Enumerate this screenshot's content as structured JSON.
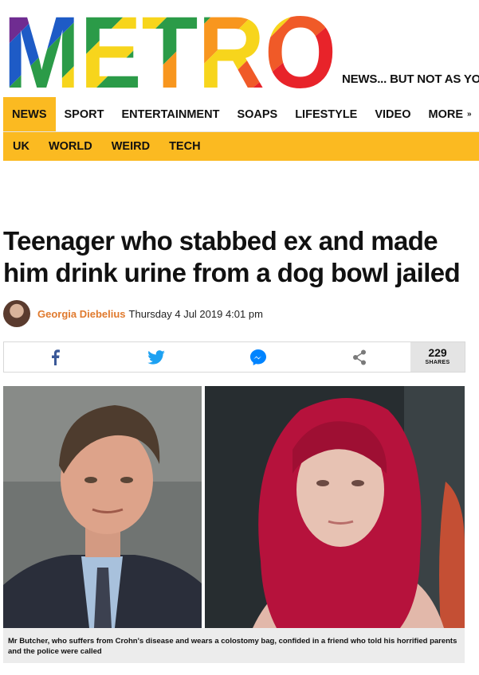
{
  "brand": {
    "logo_text": "METRO",
    "tagline": "NEWS... BUT NOT AS YOU KNOW IT"
  },
  "nav": {
    "primary": [
      "NEWS",
      "SPORT",
      "ENTERTAINMENT",
      "SOAPS",
      "LIFESTYLE",
      "VIDEO",
      "MORE"
    ],
    "active": "NEWS",
    "secondary": [
      "UK",
      "WORLD",
      "WEIRD",
      "TECH"
    ]
  },
  "article": {
    "headline": "Teenager who stabbed ex and made him drink urine from a dog bowl jailed",
    "author": "Georgia Diebelius",
    "date": "Thursday 4 Jul 2019 4:01 pm"
  },
  "share": {
    "count": "229",
    "count_label": "SHARES",
    "icons": [
      "facebook-icon",
      "twitter-icon",
      "messenger-icon",
      "share-icon"
    ],
    "colors": {
      "facebook": "#3b5998",
      "twitter": "#1da1f2",
      "messenger": "#0084ff",
      "share": "#7a7a7a"
    }
  },
  "media": {
    "caption": "Mr Butcher, who suffers from Crohn's disease and wears a colostomy bag, confided in a friend who told his horrified parents and the police were called"
  },
  "colors": {
    "accent": "#fbba21",
    "author": "#e07a2e"
  }
}
